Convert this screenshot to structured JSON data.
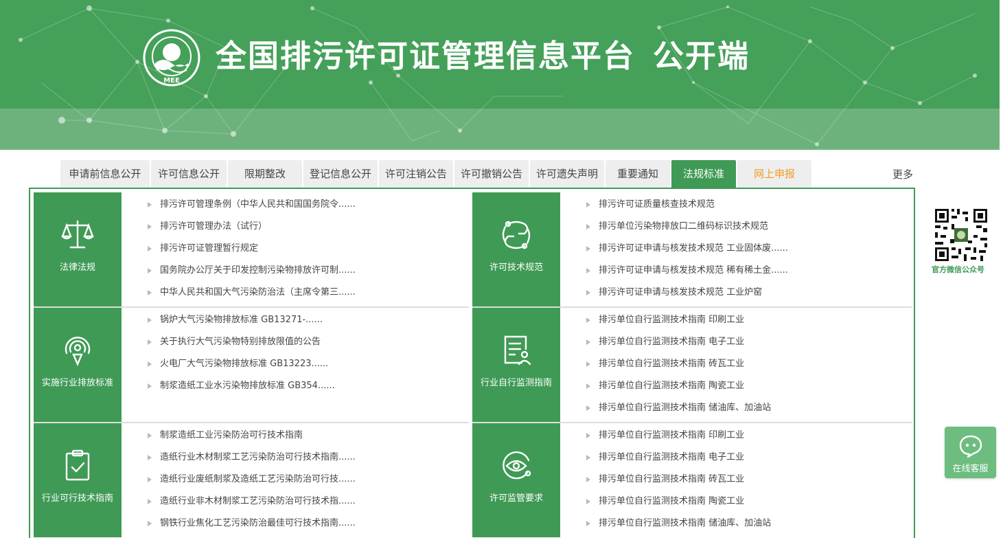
{
  "header": {
    "logo_text": "MEE",
    "title": "全国排污许可证管理信息平台",
    "subtitle": "公开端"
  },
  "tabs": [
    {
      "label": "申请前信息公开",
      "w": 130
    },
    {
      "label": "许可信息公开",
      "w": 110
    },
    {
      "label": "限期整改",
      "w": 108
    },
    {
      "label": "登记信息公开",
      "w": 108
    },
    {
      "label": "许可注销公告",
      "w": 108
    },
    {
      "label": "许可撤销公告",
      "w": 108
    },
    {
      "label": "许可遗失声明",
      "w": 108
    },
    {
      "label": "重要通知",
      "w": 94
    },
    {
      "label": "法规标准",
      "w": 94
    },
    {
      "label": "网上申报",
      "w": 108
    }
  ],
  "more_label": "更多",
  "panels": [
    {
      "category": "法律法规",
      "icon": "scale-icon",
      "items": [
        "排污许可管理条例（中华人民共和国国务院令......",
        "排污许可管理办法（试行）",
        "排污许可证管理暂行规定",
        "国务院办公厅关于印发控制污染物排放许可制......",
        "中华人民共和国大气污染防治法（主席令第三......"
      ]
    },
    {
      "category": "许可技术规范",
      "icon": "swirl-icon",
      "items": [
        "排污许可证质量核查技术规范",
        "排污单位污染物排放口二维码标识技术规范",
        "排污许可证申请与核发技术规范 工业固体废......",
        "排污许可证申请与核发技术规范 稀有稀土金......",
        "排污许可证申请与核发技术规范 工业炉窑"
      ]
    },
    {
      "category": "实施行业排放标准",
      "icon": "signal-pin-icon",
      "items": [
        "锅炉大气污染物排放标准 GB13271-......",
        "关于执行大气污染物特别排放限值的公告",
        "火电厂大气污染物排放标准 GB13223......",
        "制浆造纸工业水污染物排放标准 GB354......"
      ]
    },
    {
      "category": "行业自行监测指南",
      "icon": "document-user-icon",
      "items": [
        "排污单位自行监测技术指南 印刷工业",
        "排污单位自行监测技术指南 电子工业",
        "排污单位自行监测技术指南 砖瓦工业",
        "排污单位自行监测技术指南 陶瓷工业",
        "排污单位自行监测技术指南 储油库、加油站"
      ]
    },
    {
      "category": "行业可行技术指南",
      "icon": "clipboard-check-icon",
      "items": [
        "制浆造纸工业污染防治可行技术指南",
        "造纸行业木材制浆工艺污染防治可行技术指南......",
        "造纸行业废纸制浆及造纸工艺污染防治可行技......",
        "造纸行业非木材制浆工艺污染防治可行技术指......",
        "钢铁行业焦化工艺污染防治最佳可行技术指南......"
      ]
    },
    {
      "category": "许可监管要求",
      "icon": "eye-icon",
      "items": [
        "排污单位自行监测技术指南 印刷工业",
        "排污单位自行监测技术指南 电子工业",
        "排污单位自行监测技术指南 砖瓦工业",
        "排污单位自行监测技术指南 陶瓷工业",
        "排污单位自行监测技术指南 储油库、加油站"
      ]
    }
  ],
  "qr_label": "官方微信公众号",
  "service_label": "在线客服",
  "colors": {
    "brand_green": "#3f9a55",
    "banner_green": "#45a05a",
    "accent_orange": "#f29b1e"
  }
}
